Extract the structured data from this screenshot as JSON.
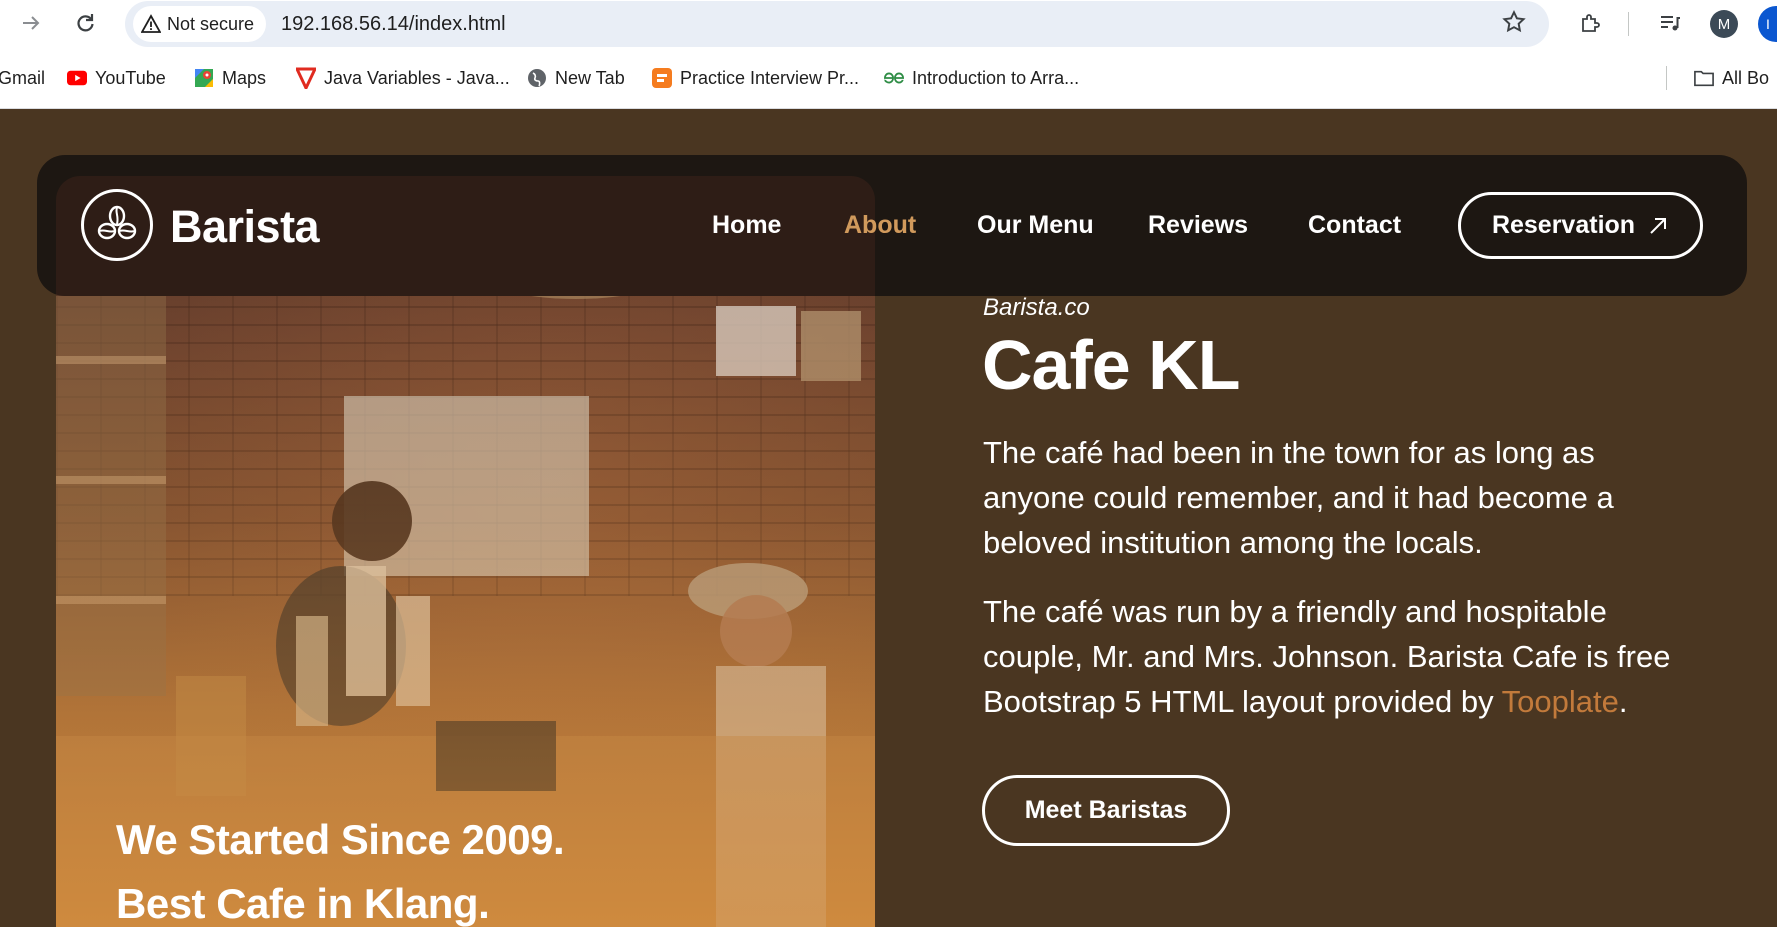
{
  "browser": {
    "security_label": "Not secure",
    "url": "192.168.56.14/index.html",
    "profile_initial": "M",
    "edge_label": "I"
  },
  "bookmarks": {
    "items": [
      {
        "label": "Gmail",
        "icon": "gmail-icon"
      },
      {
        "label": "YouTube",
        "icon": "youtube-icon"
      },
      {
        "label": "Maps",
        "icon": "maps-icon"
      },
      {
        "label": "Java Variables - Java...",
        "icon": "tutorial-icon"
      },
      {
        "label": "New Tab",
        "icon": "globe-icon"
      },
      {
        "label": "Practice Interview Pr...",
        "icon": "practice-icon"
      },
      {
        "label": "Introduction to Arra...",
        "icon": "gfg-icon"
      }
    ],
    "all_bookmarks": "All Bo"
  },
  "nav": {
    "brand": "Barista",
    "links": [
      "Home",
      "About",
      "Our Menu",
      "Reviews",
      "Contact"
    ],
    "active": "About",
    "reservation": "Reservation"
  },
  "hero": {
    "caption_line1": "We Started Since 2009.",
    "caption_line2": "Best Cafe in Klang."
  },
  "about": {
    "eyebrow": "Barista.co",
    "title": "Cafe KL",
    "p1": "The café had been in the town for as long as anyone could remember, and it had become a beloved institution among the locals.",
    "p2_start": "The café was run by a friendly and hospitable couple, Mr. and Mrs. Johnson. Barista Cafe is free Bootstrap 5 HTML layout provided by ",
    "p2_link": "Tooplate",
    "p2_end": ".",
    "button": "Meet Baristas"
  },
  "colors": {
    "page_bg": "#4a3621",
    "navbar_bg": "#1d1712",
    "accent": "#d19a5c",
    "link": "#c27a3b"
  }
}
